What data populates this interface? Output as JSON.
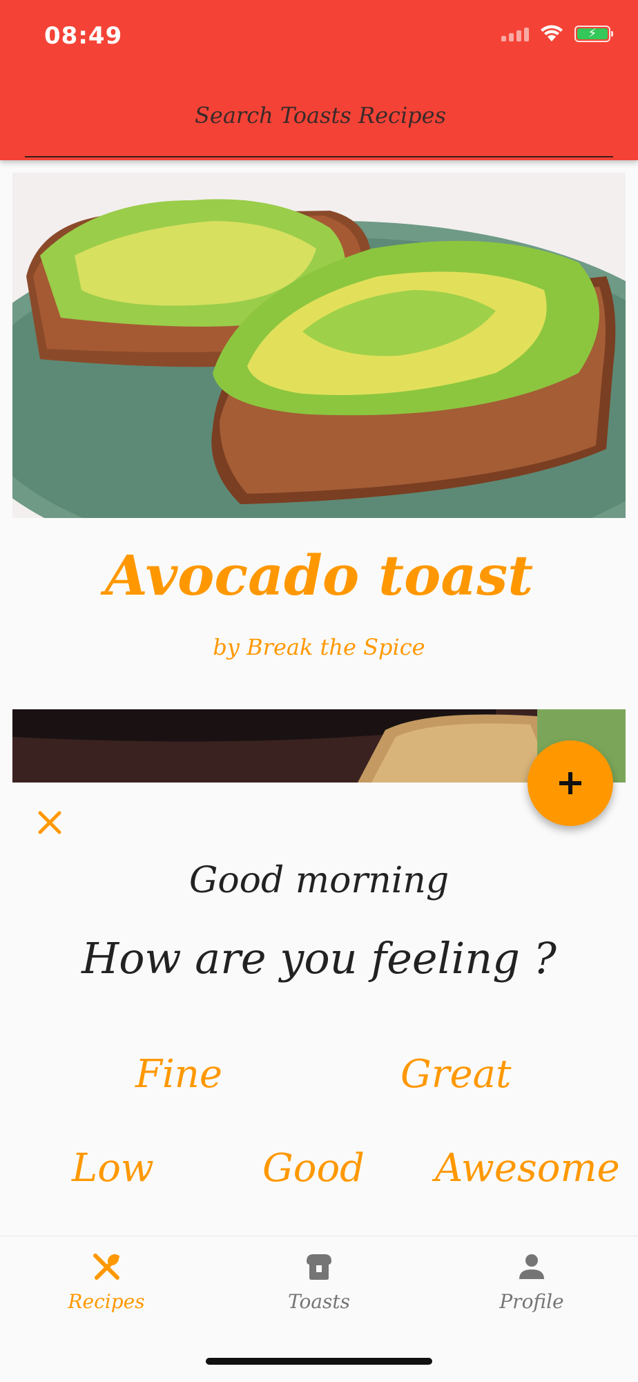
{
  "status_bar": {
    "time": "08:49"
  },
  "search": {
    "placeholder": "Search Toasts Recipes",
    "value": ""
  },
  "recipe": {
    "title": "Avocado toast",
    "author": "by Break the Spice"
  },
  "mood_prompt": {
    "greeting": "Good morning",
    "question": "How are you feeling ?",
    "options": [
      "Fine",
      "Great",
      "Low",
      "Good",
      "Awesome"
    ]
  },
  "bottom_nav": {
    "items": [
      {
        "label": "Recipes",
        "icon": "utensils-icon",
        "active": true
      },
      {
        "label": "Toasts",
        "icon": "toast-icon",
        "active": false
      },
      {
        "label": "Profile",
        "icon": "person-icon",
        "active": false
      }
    ]
  },
  "colors": {
    "header": "#f44336",
    "accent": "#ff9800",
    "inactive": "#757575"
  }
}
